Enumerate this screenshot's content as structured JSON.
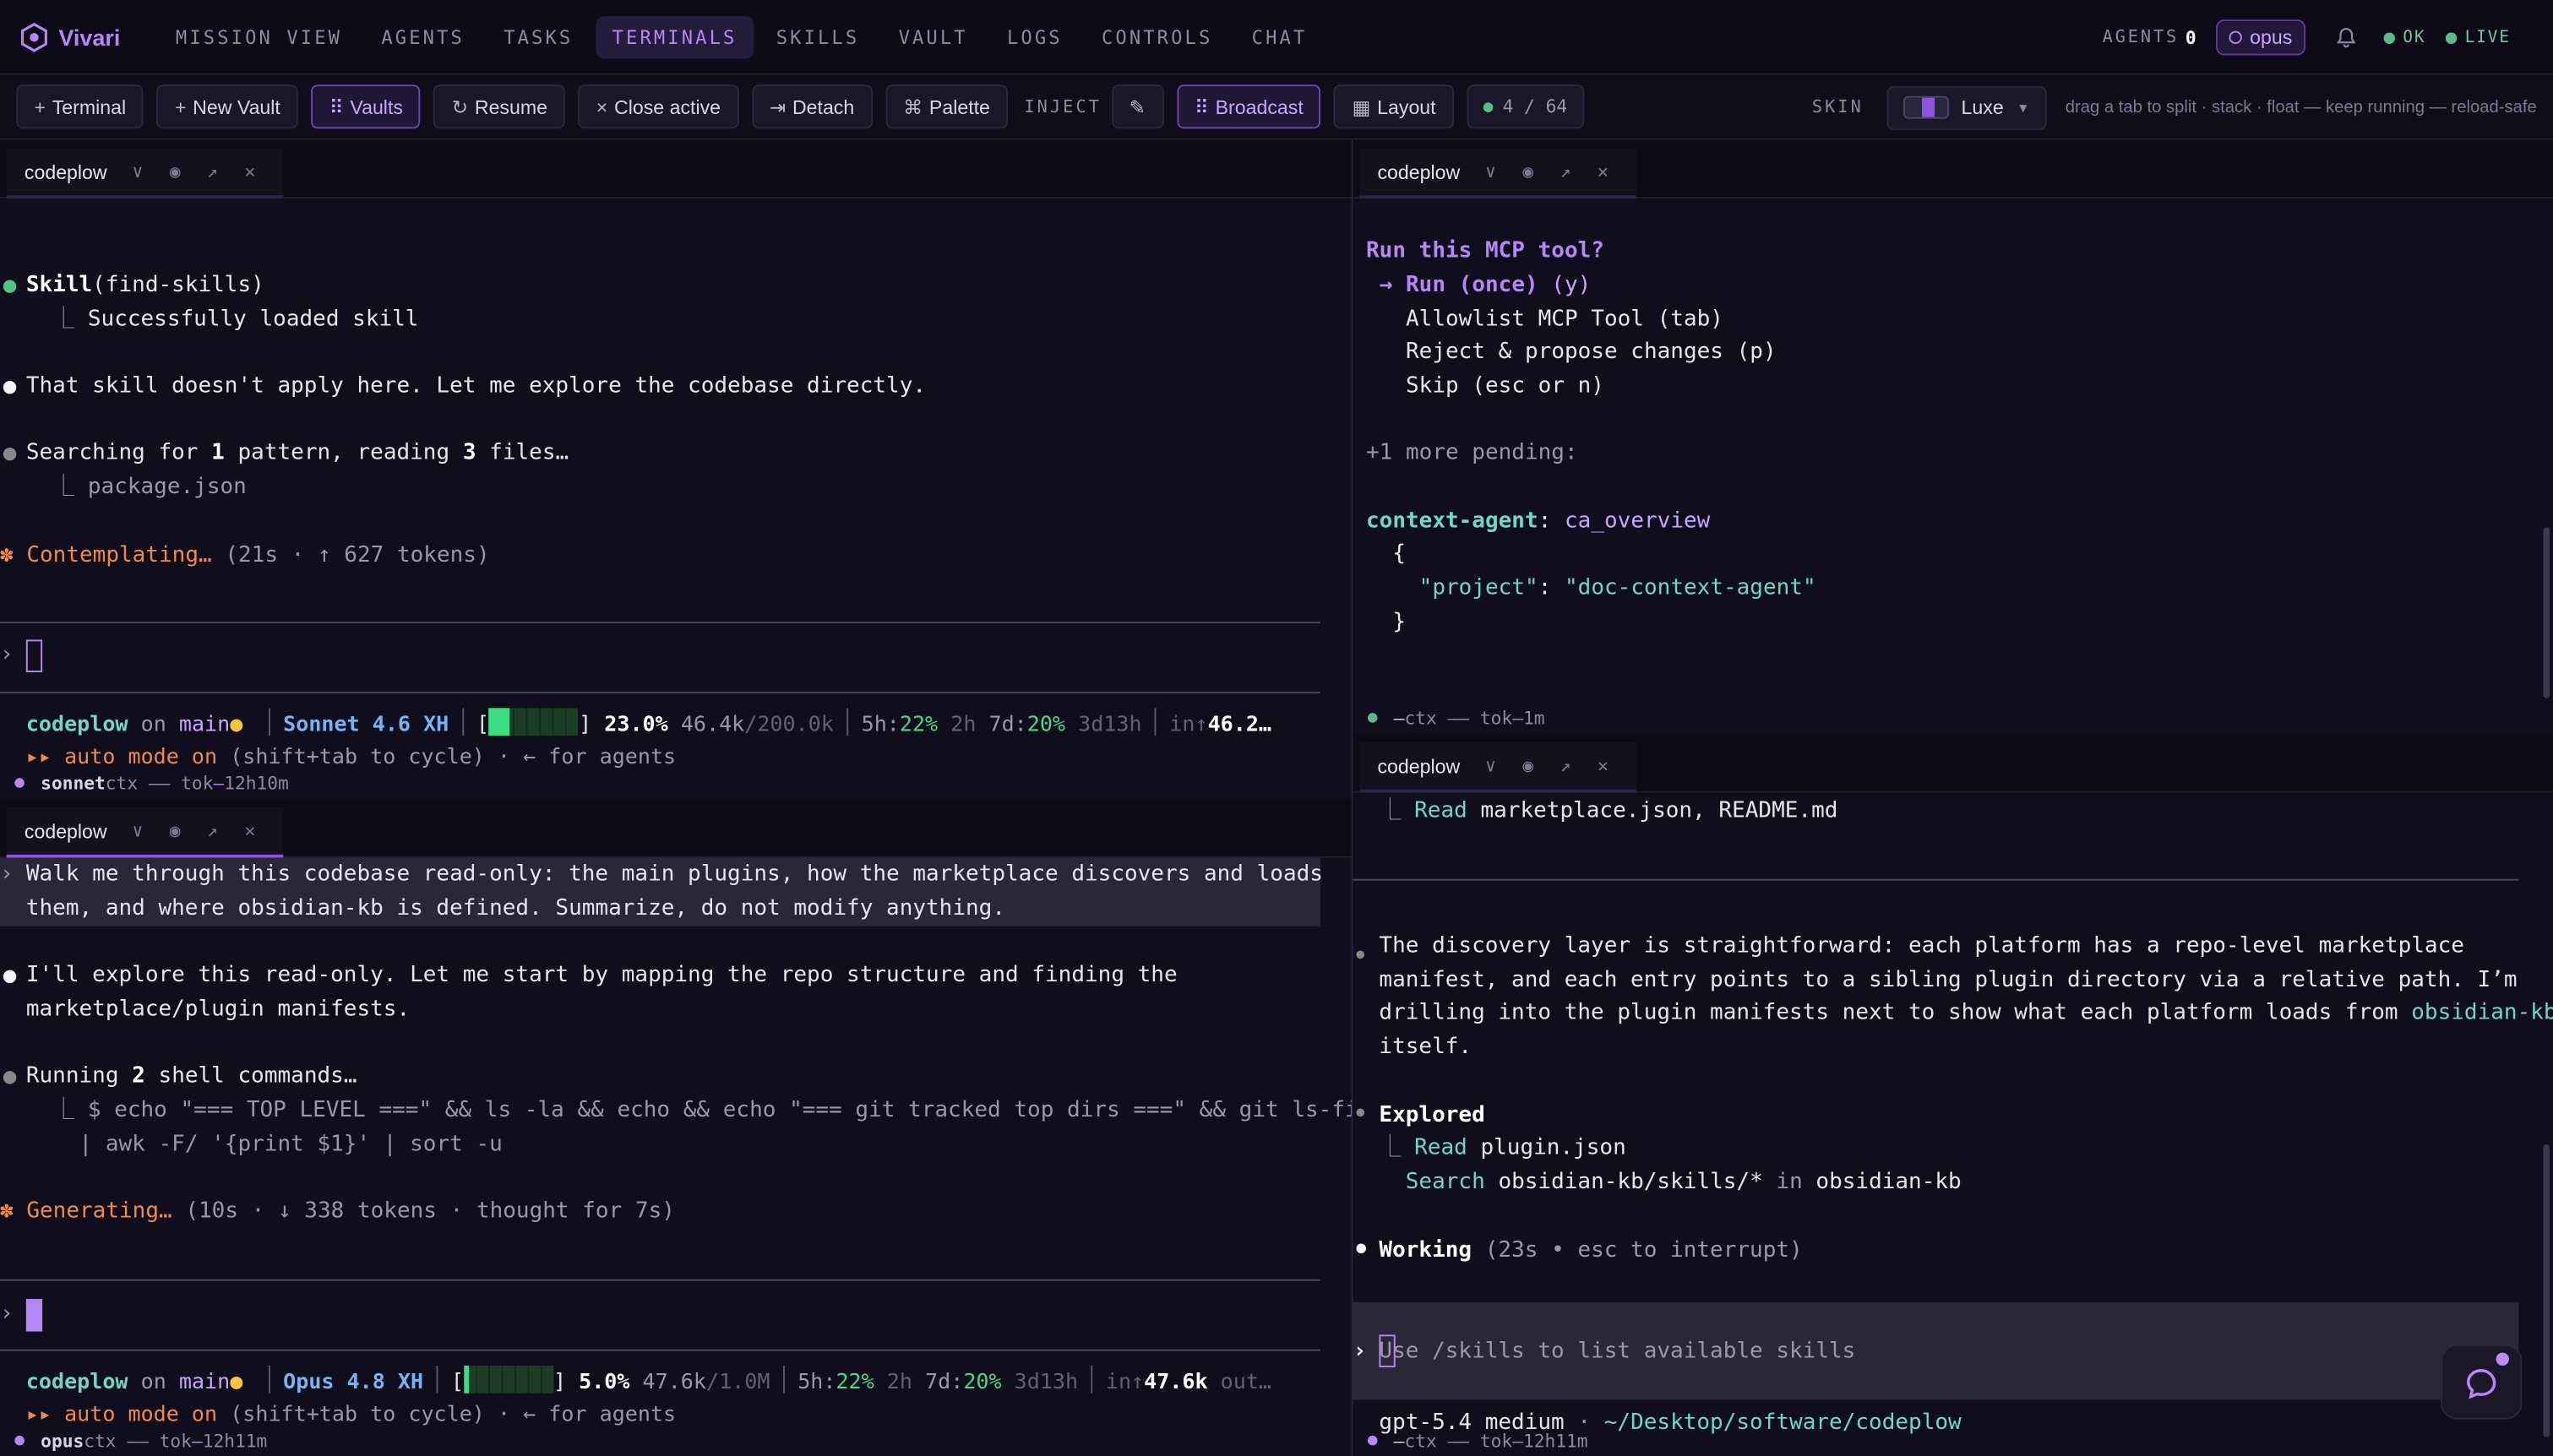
{
  "app": {
    "name": "Vivari"
  },
  "nav": {
    "items": [
      "MISSION VIEW",
      "AGENTS",
      "TASKS",
      "TERMINALS",
      "SKILLS",
      "VAULT",
      "LOGS",
      "CONTROLS",
      "CHAT"
    ],
    "active": "TERMINALS",
    "agents_label": "AGENTS",
    "agents_count": "0",
    "model_chip": "opus",
    "status_ok": "OK",
    "status_live": "LIVE"
  },
  "toolbar": {
    "terminal": "Terminal",
    "new_vault": "New Vault",
    "vaults": "Vaults",
    "resume": "Resume",
    "close_active": "Close active",
    "detach": "Detach",
    "palette": "Palette",
    "inject": "INJECT",
    "broadcast": "Broadcast",
    "layout": "Layout",
    "counter": "4 / 64",
    "skin_label": "SKIN",
    "skin_value": "Luxe",
    "hint": "drag a tab to split · stack · float — keep running — reload-safe"
  },
  "colors": {
    "accent": "#b487f5",
    "ok": "#5bb98a",
    "bg": "#100e1c"
  },
  "icons": [
    "vivari-logo-icon",
    "bell-icon",
    "chat-bubble-icon",
    "pin-icon",
    "popout-icon",
    "close-icon",
    "chevron-down-icon"
  ],
  "panes": {
    "tl": {
      "tab": "codeplow",
      "skill": "Skill",
      "skill_arg": "(find-skills)",
      "skill_ok": "Successfully loaded skill",
      "l1": "That skill doesn't apply here. Let me explore the codebase directly.",
      "s1": "Searching for ",
      "s1b": "1",
      "s1c": " pattern, reading ",
      "s1d": "3",
      "s1e": " files…",
      "s2": "package.json",
      "cont": "Contemplating…",
      "cont_meta": " (21s · ↑ 627 tokens)",
      "st_repo": "codeplow",
      "st_on": " on ",
      "st_branch": "main",
      "st_model": "Sonnet 4.6 XH",
      "st_pct": "23.0%",
      "st_tok": "46.4k",
      "st_max": "/200.0k",
      "st_5h": "5h:",
      "st_5hv": "22%",
      "st_5hr": " 2h",
      "st_7d": " 7d:",
      "st_7dv": "20%",
      "st_7dr": " 3d13h",
      "st_in": "in↑",
      "st_inv": "46.2…",
      "auto": "▸▸ auto mode on",
      "auto2": " (shift+tab to cycle) · ← for agents",
      "foot_model": "sonnet",
      "foot_ctx": "ctx —",
      "foot_tok": "— tok",
      "foot_dash": "—",
      "foot_time": "12h10m"
    },
    "tr": {
      "tab": "codeplow",
      "q": "Run this MCP tool?",
      "o1": "→ Run (once)",
      "o1k": " (y)",
      "o2": "Allowlist MCP Tool (tab)",
      "o3": "Reject & propose changes (p)",
      "o4": "Skip (esc or n)",
      "pend": "+1 more pending:",
      "ctx": "context-agent",
      "ctx2": ": ",
      "ctxf": "ca_overview",
      "j1": "{",
      "jk": "\"project\"",
      "jc": ": ",
      "jv": "\"doc-context-agent\"",
      "j2": "}",
      "foot_ctx": "ctx —",
      "foot_tok": "— tok",
      "foot_dash": "—",
      "foot_time": "1m"
    },
    "bl": {
      "tab": "codeplow",
      "u1": "Walk me through this codebase read-only: the main plugins, how the marketplace discovers and loads",
      "u2": "them, and where obsidian-kb is defined. Summarize, do not modify anything.",
      "a1": "I'll explore this read-only. Let me start by mapping the repo structure and finding the",
      "a2": "marketplace/plugin manifests.",
      "r1": "Running ",
      "r1b": "2",
      "r1c": " shell commands…",
      "c1": "$ echo \"=== TOP LEVEL ===\" && ls -la && echo && echo \"=== git tracked top dirs ===\" && git ls-files",
      "c2": "| awk -F/ '{print $1}' | sort -u",
      "gen": "Generating…",
      "gen_meta": " (10s · ↓ 338 tokens · thought for 7s)",
      "st_repo": "codeplow",
      "st_on": " on ",
      "st_branch": "main",
      "st_model": "Opus 4.8 XH",
      "st_pct": "5.0%",
      "st_tok": "47.6k",
      "st_max": "/1.0M",
      "st_5h": "5h:",
      "st_5hv": "22%",
      "st_5hr": " 2h",
      "st_7d": " 7d:",
      "st_7dv": "20%",
      "st_7dr": " 3d13h",
      "st_in": "in↑",
      "st_inv": "47.6k",
      "st_out": " out…",
      "auto": "▸▸ auto mode on",
      "auto2": " (shift+tab to cycle) · ← for agents",
      "foot_model": "opus",
      "foot_ctx": "ctx —",
      "foot_tok": "— tok",
      "foot_dash": "—",
      "foot_time": "12h11m"
    },
    "br": {
      "tab": "codeplow",
      "rd": "Read",
      "rdf": " marketplace.json, README.md",
      "p1": "The discovery layer is straightforward: each platform has a repo-level marketplace",
      "p2": "manifest, and each entry points to a sibling plugin directory via a relative path. I’m",
      "p3": "drilling into the plugin manifests next to show what each platform loads from ",
      "p3b": "obsidian-kb",
      "p4": "itself.",
      "ex": "Explored",
      "ex1": "Read",
      "ex1f": " plugin.json",
      "ex2": "Search",
      "ex2f": " obsidian-kb/skills/*",
      "ex2in": " in ",
      "ex2d": "obsidian-kb",
      "wk": "Working",
      "wk_meta": " (23s • esc to interrupt)",
      "prompt": "Use /skills to list available skills",
      "model_line": "gpt-5.4 medium",
      "model_sep": " · ",
      "model_path": "~/Desktop/software/codeplow",
      "foot_ctx": "ctx —",
      "foot_tok": "— tok",
      "foot_dash": "—",
      "foot_time": "12h11m"
    }
  }
}
